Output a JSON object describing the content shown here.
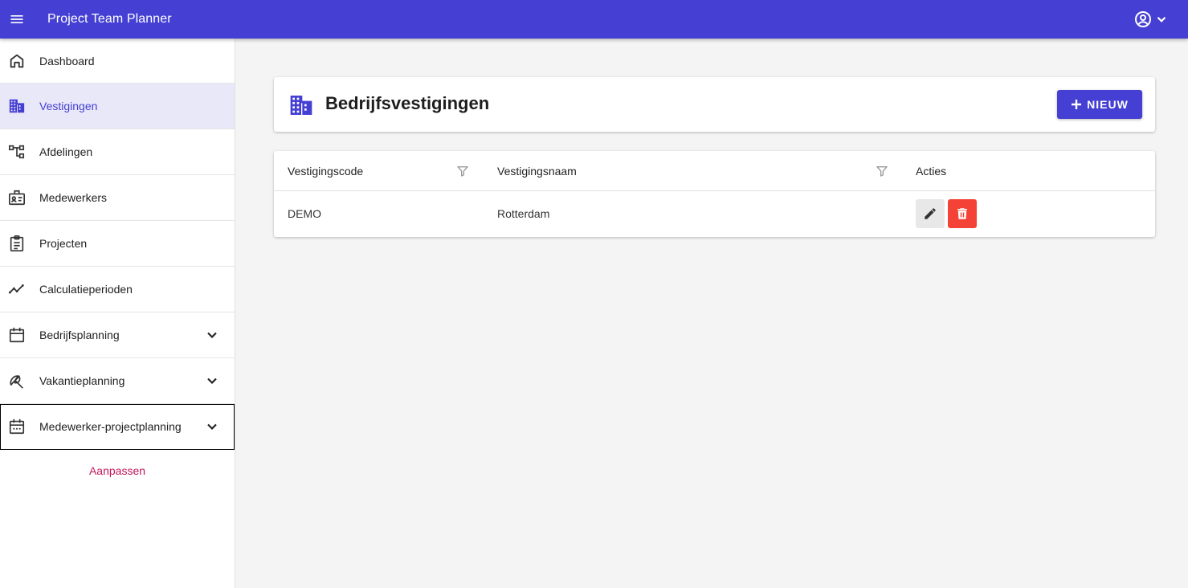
{
  "app": {
    "title": "Project Team Planner"
  },
  "colors": {
    "primary": "#4540d3",
    "danger": "#f44336",
    "accent": "#c2185b"
  },
  "sidebar": {
    "items": [
      {
        "label": "Dashboard",
        "icon": "home-icon"
      },
      {
        "label": "Vestigingen",
        "icon": "building-icon",
        "active": true
      },
      {
        "label": "Afdelingen",
        "icon": "org-chart-icon"
      },
      {
        "label": "Medewerkers",
        "icon": "badge-icon"
      },
      {
        "label": "Projecten",
        "icon": "clipboard-icon"
      },
      {
        "label": "Calculatieperioden",
        "icon": "trend-line-icon"
      },
      {
        "label": "Bedrijfsplanning",
        "icon": "calendar-icon",
        "expandable": true
      },
      {
        "label": "Vakantieplanning",
        "icon": "beach-umbrella-icon",
        "expandable": true
      },
      {
        "label": "Medewerker-projectplanning",
        "icon": "calendar-dots-icon",
        "expandable": true
      }
    ],
    "customize_label": "Aanpassen"
  },
  "page": {
    "title": "Bedrijfsvestigingen",
    "new_button_label": "NIEUW"
  },
  "table": {
    "columns": [
      "Vestigingscode",
      "Vestigingsnaam",
      "Acties"
    ],
    "rows": [
      {
        "code": "DEMO",
        "name": "Rotterdam"
      }
    ]
  }
}
